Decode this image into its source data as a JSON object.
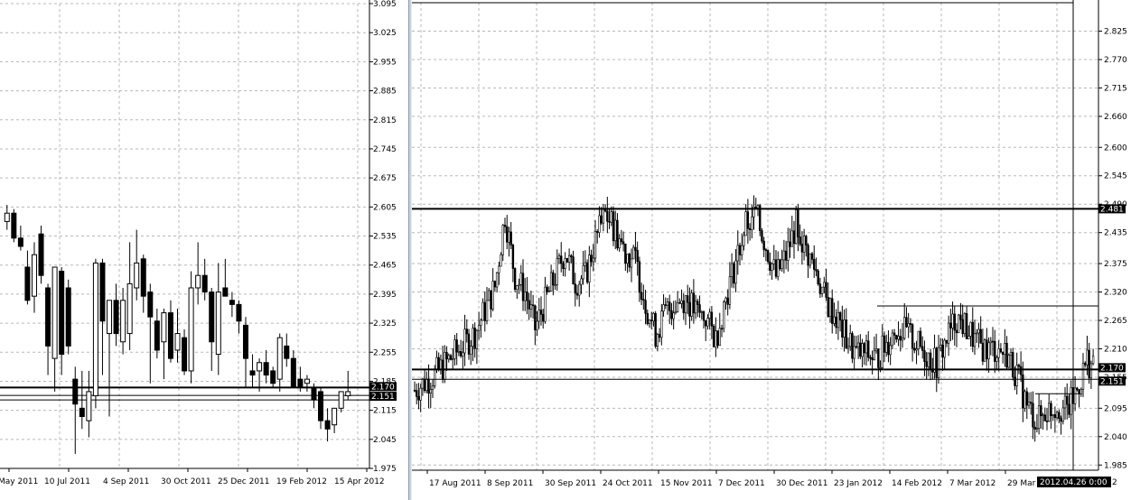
{
  "chart_data": [
    {
      "type": "candlestick",
      "ylim": [
        1.975,
        3.095
      ],
      "y_ticks": [
        "3.095",
        "3.025",
        "2.955",
        "2.885",
        "2.815",
        "2.745",
        "2.675",
        "2.605",
        "2.535",
        "2.465",
        "2.395",
        "2.325",
        "2.255",
        "2.185",
        "2.115",
        "2.045",
        "1.975"
      ],
      "x_ticks": [
        "May 2011",
        "10 Jul 2011",
        "4 Sep 2011",
        "30 Oct 2011",
        "25 Dec 2011",
        "19 Feb 2012",
        "15 Apr 2012"
      ],
      "grid": true,
      "price_lines": [
        2.17,
        2.151
      ],
      "price_labels": [
        "2.170",
        "2.151"
      ],
      "candles": [
        {
          "o": 2.57,
          "h": 2.61,
          "l": 2.55,
          "c": 2.59
        },
        {
          "o": 2.59,
          "h": 2.6,
          "l": 2.52,
          "c": 2.53
        },
        {
          "o": 2.53,
          "h": 2.56,
          "l": 2.5,
          "c": 2.51
        },
        {
          "o": 2.46,
          "h": 2.5,
          "l": 2.37,
          "c": 2.38
        },
        {
          "o": 2.39,
          "h": 2.52,
          "l": 2.35,
          "c": 2.49
        },
        {
          "o": 2.54,
          "h": 2.56,
          "l": 2.42,
          "c": 2.44
        },
        {
          "o": 2.41,
          "h": 2.42,
          "l": 2.2,
          "c": 2.27
        },
        {
          "o": 2.24,
          "h": 2.43,
          "l": 2.16,
          "c": 2.46
        },
        {
          "o": 2.45,
          "h": 2.46,
          "l": 2.2,
          "c": 2.25
        },
        {
          "o": 2.41,
          "h": 2.43,
          "l": 2.25,
          "c": 2.27
        },
        {
          "o": 2.19,
          "h": 2.22,
          "l": 2.01,
          "c": 2.13
        },
        {
          "o": 2.12,
          "h": 2.21,
          "l": 2.07,
          "c": 2.1
        },
        {
          "o": 2.09,
          "h": 2.21,
          "l": 2.05,
          "c": 2.16
        },
        {
          "o": 2.15,
          "h": 2.48,
          "l": 2.12,
          "c": 2.47
        },
        {
          "o": 2.47,
          "h": 2.48,
          "l": 2.2,
          "c": 2.33
        },
        {
          "o": 2.3,
          "h": 2.38,
          "l": 2.1,
          "c": 2.38
        },
        {
          "o": 2.38,
          "h": 2.42,
          "l": 2.27,
          "c": 2.3
        },
        {
          "o": 2.28,
          "h": 2.41,
          "l": 2.25,
          "c": 2.38
        },
        {
          "o": 2.3,
          "h": 2.52,
          "l": 2.26,
          "c": 2.42
        },
        {
          "o": 2.41,
          "h": 2.55,
          "l": 2.38,
          "c": 2.47
        },
        {
          "o": 2.48,
          "h": 2.49,
          "l": 2.35,
          "c": 2.39
        },
        {
          "o": 2.4,
          "h": 2.42,
          "l": 2.18,
          "c": 2.34
        },
        {
          "o": 2.33,
          "h": 2.36,
          "l": 2.24,
          "c": 2.26
        },
        {
          "o": 2.28,
          "h": 2.36,
          "l": 2.19,
          "c": 2.35
        },
        {
          "o": 2.35,
          "h": 2.38,
          "l": 2.23,
          "c": 2.24
        },
        {
          "o": 2.26,
          "h": 2.36,
          "l": 2.23,
          "c": 2.3
        },
        {
          "o": 2.29,
          "h": 2.31,
          "l": 2.2,
          "c": 2.21
        },
        {
          "o": 2.21,
          "h": 2.45,
          "l": 2.18,
          "c": 2.41
        },
        {
          "o": 2.41,
          "h": 2.52,
          "l": 2.37,
          "c": 2.44
        },
        {
          "o": 2.44,
          "h": 2.48,
          "l": 2.38,
          "c": 2.4
        },
        {
          "o": 2.4,
          "h": 2.41,
          "l": 2.21,
          "c": 2.28
        },
        {
          "o": 2.25,
          "h": 2.47,
          "l": 2.2,
          "c": 2.4
        },
        {
          "o": 2.41,
          "h": 2.48,
          "l": 2.39,
          "c": 2.39
        },
        {
          "o": 2.38,
          "h": 2.4,
          "l": 2.34,
          "c": 2.37
        },
        {
          "o": 2.37,
          "h": 2.38,
          "l": 2.3,
          "c": 2.33
        },
        {
          "o": 2.32,
          "h": 2.34,
          "l": 2.17,
          "c": 2.24
        },
        {
          "o": 2.21,
          "h": 2.25,
          "l": 2.17,
          "c": 2.2
        },
        {
          "o": 2.21,
          "h": 2.24,
          "l": 2.16,
          "c": 2.23
        },
        {
          "o": 2.23,
          "h": 2.26,
          "l": 2.18,
          "c": 2.2
        },
        {
          "o": 2.21,
          "h": 2.22,
          "l": 2.17,
          "c": 2.18
        },
        {
          "o": 2.19,
          "h": 2.3,
          "l": 2.16,
          "c": 2.29
        },
        {
          "o": 2.27,
          "h": 2.3,
          "l": 2.22,
          "c": 2.24
        },
        {
          "o": 2.24,
          "h": 2.26,
          "l": 2.17,
          "c": 2.17
        },
        {
          "o": 2.19,
          "h": 2.22,
          "l": 2.16,
          "c": 2.17
        },
        {
          "o": 2.18,
          "h": 2.2,
          "l": 2.16,
          "c": 2.19
        },
        {
          "o": 2.17,
          "h": 2.18,
          "l": 2.12,
          "c": 2.14
        },
        {
          "o": 2.16,
          "h": 2.17,
          "l": 2.07,
          "c": 2.09
        },
        {
          "o": 2.09,
          "h": 2.12,
          "l": 2.04,
          "c": 2.07
        },
        {
          "o": 2.08,
          "h": 2.12,
          "l": 2.06,
          "c": 2.12
        },
        {
          "o": 2.12,
          "h": 2.16,
          "l": 2.11,
          "c": 2.16
        },
        {
          "o": 2.15,
          "h": 2.21,
          "l": 2.14,
          "c": 2.16
        }
      ]
    },
    {
      "type": "candlestick",
      "ylim": [
        1.975,
        2.88
      ],
      "y_ticks": [
        "2.825",
        "2.770",
        "2.715",
        "2.660",
        "2.600",
        "2.545",
        "2.490",
        "2.435",
        "2.375",
        "2.320",
        "2.265",
        "2.210",
        "2.155",
        "2.095",
        "2.040",
        "1.985"
      ],
      "x_ticks": [
        "17 Aug 2011",
        "8 Sep 2011",
        "30 Sep 2011",
        "24 Oct 2011",
        "15 Nov 2011",
        "7 Dec 2011",
        "30 Dec 2011",
        "23 Jan 2012",
        "14 Feb 2012",
        "7 Mar 2012",
        "29 Mar"
      ],
      "grid": true,
      "crosshair_label": "2012.04.26 0:00",
      "edge_label": "2",
      "price_lines": [
        2.481,
        2.17,
        2.151
      ],
      "price_labels": [
        "2.481",
        "2.170",
        "2.151"
      ],
      "levels": [
        {
          "value": 2.481
        },
        {
          "value": 2.293
        }
      ],
      "anchors": [
        {
          "x": 0,
          "y": 2.13
        },
        {
          "x": 10,
          "y": 2.16
        },
        {
          "x": 20,
          "y": 2.2
        },
        {
          "x": 30,
          "y": 2.24
        },
        {
          "x": 40,
          "y": 2.33
        },
        {
          "x": 45,
          "y": 2.47
        },
        {
          "x": 50,
          "y": 2.35
        },
        {
          "x": 55,
          "y": 2.32
        },
        {
          "x": 60,
          "y": 2.25
        },
        {
          "x": 65,
          "y": 2.3
        },
        {
          "x": 70,
          "y": 2.35
        },
        {
          "x": 75,
          "y": 2.4
        },
        {
          "x": 80,
          "y": 2.34
        },
        {
          "x": 85,
          "y": 2.35
        },
        {
          "x": 90,
          "y": 2.42
        },
        {
          "x": 95,
          "y": 2.47
        },
        {
          "x": 100,
          "y": 2.44
        },
        {
          "x": 105,
          "y": 2.4
        },
        {
          "x": 110,
          "y": 2.38
        },
        {
          "x": 115,
          "y": 2.3
        },
        {
          "x": 120,
          "y": 2.24
        },
        {
          "x": 125,
          "y": 2.28
        },
        {
          "x": 130,
          "y": 2.3
        },
        {
          "x": 135,
          "y": 2.31
        },
        {
          "x": 140,
          "y": 2.28
        },
        {
          "x": 145,
          "y": 2.27
        },
        {
          "x": 150,
          "y": 2.23
        },
        {
          "x": 155,
          "y": 2.31
        },
        {
          "x": 160,
          "y": 2.38
        },
        {
          "x": 165,
          "y": 2.45
        },
        {
          "x": 170,
          "y": 2.47
        },
        {
          "x": 175,
          "y": 2.41
        },
        {
          "x": 180,
          "y": 2.35
        },
        {
          "x": 185,
          "y": 2.39
        },
        {
          "x": 190,
          "y": 2.45
        },
        {
          "x": 195,
          "y": 2.4
        },
        {
          "x": 200,
          "y": 2.36
        },
        {
          "x": 205,
          "y": 2.3
        },
        {
          "x": 210,
          "y": 2.27
        },
        {
          "x": 215,
          "y": 2.23
        },
        {
          "x": 220,
          "y": 2.2
        },
        {
          "x": 225,
          "y": 2.2
        },
        {
          "x": 230,
          "y": 2.19
        },
        {
          "x": 235,
          "y": 2.22
        },
        {
          "x": 240,
          "y": 2.25
        },
        {
          "x": 245,
          "y": 2.24
        },
        {
          "x": 250,
          "y": 2.22
        },
        {
          "x": 255,
          "y": 2.2
        },
        {
          "x": 260,
          "y": 2.18
        },
        {
          "x": 265,
          "y": 2.23
        },
        {
          "x": 270,
          "y": 2.27
        },
        {
          "x": 275,
          "y": 2.25
        },
        {
          "x": 280,
          "y": 2.22
        },
        {
          "x": 285,
          "y": 2.21
        },
        {
          "x": 290,
          "y": 2.21
        },
        {
          "x": 295,
          "y": 2.2
        },
        {
          "x": 300,
          "y": 2.16
        },
        {
          "x": 305,
          "y": 2.1
        },
        {
          "x": 310,
          "y": 2.07
        },
        {
          "x": 315,
          "y": 2.09
        },
        {
          "x": 320,
          "y": 2.1
        },
        {
          "x": 325,
          "y": 2.09
        },
        {
          "x": 330,
          "y": 2.13
        },
        {
          "x": 335,
          "y": 2.19
        },
        {
          "x": 338,
          "y": 2.17
        }
      ]
    }
  ]
}
